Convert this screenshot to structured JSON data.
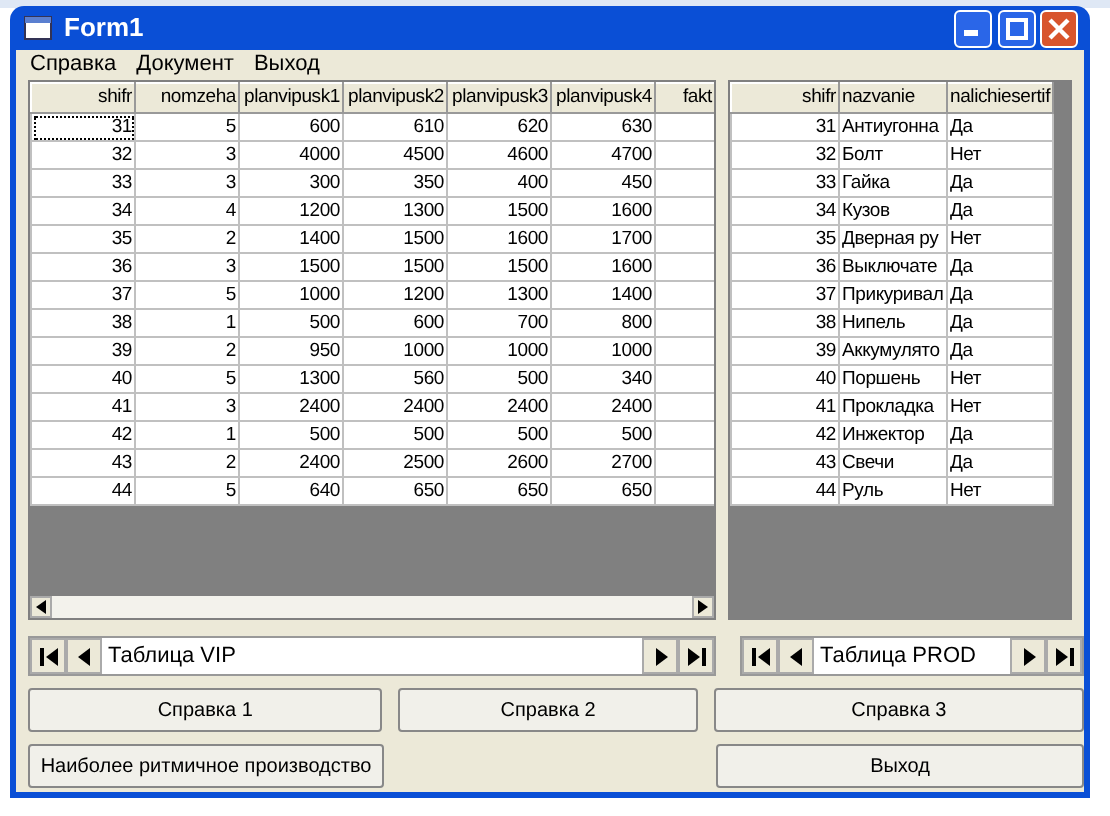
{
  "window": {
    "title": "Form1"
  },
  "menu": [
    "Справка",
    "Документ",
    "Выход"
  ],
  "left_grid": {
    "columns": [
      "shifr",
      "nomzeha",
      "planvipusk1",
      "planvipusk2",
      "planvipusk3",
      "planvipusk4",
      "fakt"
    ],
    "rows": [
      {
        "focused": true,
        "cells": [
          "31",
          "5",
          "600",
          "610",
          "620",
          "630",
          ""
        ]
      },
      {
        "focused": false,
        "cells": [
          "32",
          "3",
          "4000",
          "4500",
          "4600",
          "4700",
          ""
        ]
      },
      {
        "focused": false,
        "cells": [
          "33",
          "3",
          "300",
          "350",
          "400",
          "450",
          ""
        ]
      },
      {
        "focused": false,
        "cells": [
          "34",
          "4",
          "1200",
          "1300",
          "1500",
          "1600",
          ""
        ]
      },
      {
        "focused": false,
        "cells": [
          "35",
          "2",
          "1400",
          "1500",
          "1600",
          "1700",
          ""
        ]
      },
      {
        "focused": false,
        "cells": [
          "36",
          "3",
          "1500",
          "1500",
          "1500",
          "1600",
          ""
        ]
      },
      {
        "focused": false,
        "cells": [
          "37",
          "5",
          "1000",
          "1200",
          "1300",
          "1400",
          ""
        ]
      },
      {
        "focused": false,
        "cells": [
          "38",
          "1",
          "500",
          "600",
          "700",
          "800",
          ""
        ]
      },
      {
        "focused": false,
        "cells": [
          "39",
          "2",
          "950",
          "1000",
          "1000",
          "1000",
          ""
        ]
      },
      {
        "focused": false,
        "cells": [
          "40",
          "5",
          "1300",
          "560",
          "500",
          "340",
          ""
        ]
      },
      {
        "focused": false,
        "cells": [
          "41",
          "3",
          "2400",
          "2400",
          "2400",
          "2400",
          ""
        ]
      },
      {
        "focused": false,
        "cells": [
          "42",
          "1",
          "500",
          "500",
          "500",
          "500",
          ""
        ]
      },
      {
        "focused": false,
        "cells": [
          "43",
          "2",
          "2400",
          "2500",
          "2600",
          "2700",
          ""
        ]
      },
      {
        "focused": false,
        "cells": [
          "44",
          "5",
          "640",
          "650",
          "650",
          "650",
          ""
        ]
      }
    ]
  },
  "right_grid": {
    "columns": [
      "shifr",
      "nazvanie",
      "nalichiesertif"
    ],
    "rows": [
      {
        "cells": [
          "31",
          "Антиугонна",
          "Да"
        ]
      },
      {
        "cells": [
          "32",
          "Болт",
          "Нет"
        ]
      },
      {
        "cells": [
          "33",
          "Гайка",
          "Да"
        ]
      },
      {
        "cells": [
          "34",
          "Кузов",
          "Да"
        ]
      },
      {
        "cells": [
          "35",
          "Дверная ру",
          "Нет"
        ]
      },
      {
        "cells": [
          "36",
          "Выключате",
          "Да"
        ]
      },
      {
        "cells": [
          "37",
          "Прикуривал",
          "Да"
        ]
      },
      {
        "cells": [
          "38",
          "Нипель",
          "Да"
        ]
      },
      {
        "cells": [
          "39",
          "Аккумулято",
          "Да"
        ]
      },
      {
        "cells": [
          "40",
          "Поршень",
          "Нет"
        ]
      },
      {
        "cells": [
          "41",
          "Прокладка",
          "Нет"
        ]
      },
      {
        "cells": [
          "42",
          "Инжектор",
          "Да"
        ]
      },
      {
        "cells": [
          "43",
          "Свечи",
          "Да"
        ]
      },
      {
        "cells": [
          "44",
          "Руль",
          "Нет"
        ]
      }
    ]
  },
  "navigators": [
    {
      "caption": "Таблица VIP"
    },
    {
      "caption": "Таблица PROD"
    }
  ],
  "buttons_row1": [
    "Справка 1",
    "Справка 2",
    "Справка 3"
  ],
  "buttons_row2": [
    "Наиболее ритмичное производство",
    "Выход"
  ]
}
